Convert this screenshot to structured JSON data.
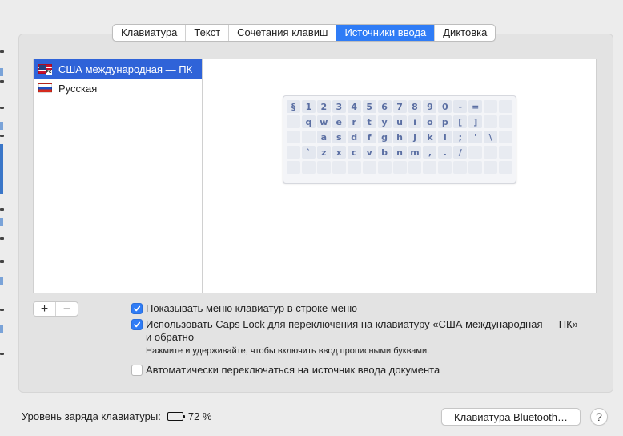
{
  "tabs": [
    {
      "label": "Клавиатура",
      "active": false
    },
    {
      "label": "Текст",
      "active": false
    },
    {
      "label": "Сочетания клавиш",
      "active": false
    },
    {
      "label": "Источники ввода",
      "active": true
    },
    {
      "label": "Диктовка",
      "active": false
    }
  ],
  "sources": [
    {
      "label": "США международная — ПК",
      "flag": "us-flag-icon",
      "selected": true
    },
    {
      "label": "Русская",
      "flag": "ru-flag-icon",
      "selected": false
    }
  ],
  "keyboard_preview": {
    "rows": [
      [
        "§",
        "1",
        "2",
        "3",
        "4",
        "5",
        "6",
        "7",
        "8",
        "9",
        "0",
        "-",
        "="
      ],
      [
        "q",
        "w",
        "e",
        "r",
        "t",
        "y",
        "u",
        "i",
        "o",
        "p",
        "[",
        "]"
      ],
      [
        "a",
        "s",
        "d",
        "f",
        "g",
        "h",
        "j",
        "k",
        "l",
        ";",
        "'",
        "\\"
      ],
      [
        "`",
        "z",
        "x",
        "c",
        "v",
        "b",
        "n",
        "m",
        ",",
        ".",
        "/"
      ]
    ]
  },
  "list_buttons": {
    "add": "+",
    "remove": "−"
  },
  "options": {
    "show_menu": {
      "label": "Показывать меню клавиатур в строке меню",
      "checked": true
    },
    "caps_lock": {
      "label_line1": "Использовать Caps Lock для переключения на клавиатуру «США международная — ПК»",
      "label_line2": "и обратно",
      "checked": true
    },
    "caps_hint": "Нажмите и удерживайте, чтобы включить ввод прописными буквами.",
    "auto_switch": {
      "label": "Автоматически переключаться на источник ввода документа",
      "checked": false
    }
  },
  "footer": {
    "battery_label": "Уровень заряда клавиатуры:",
    "battery_percent": "72 %",
    "battery_level": 0.72,
    "bluetooth_button": "Клавиатура Bluetooth…",
    "help": "?"
  },
  "colors": {
    "accent": "#2f7cf6",
    "selection": "#2f63d8"
  }
}
